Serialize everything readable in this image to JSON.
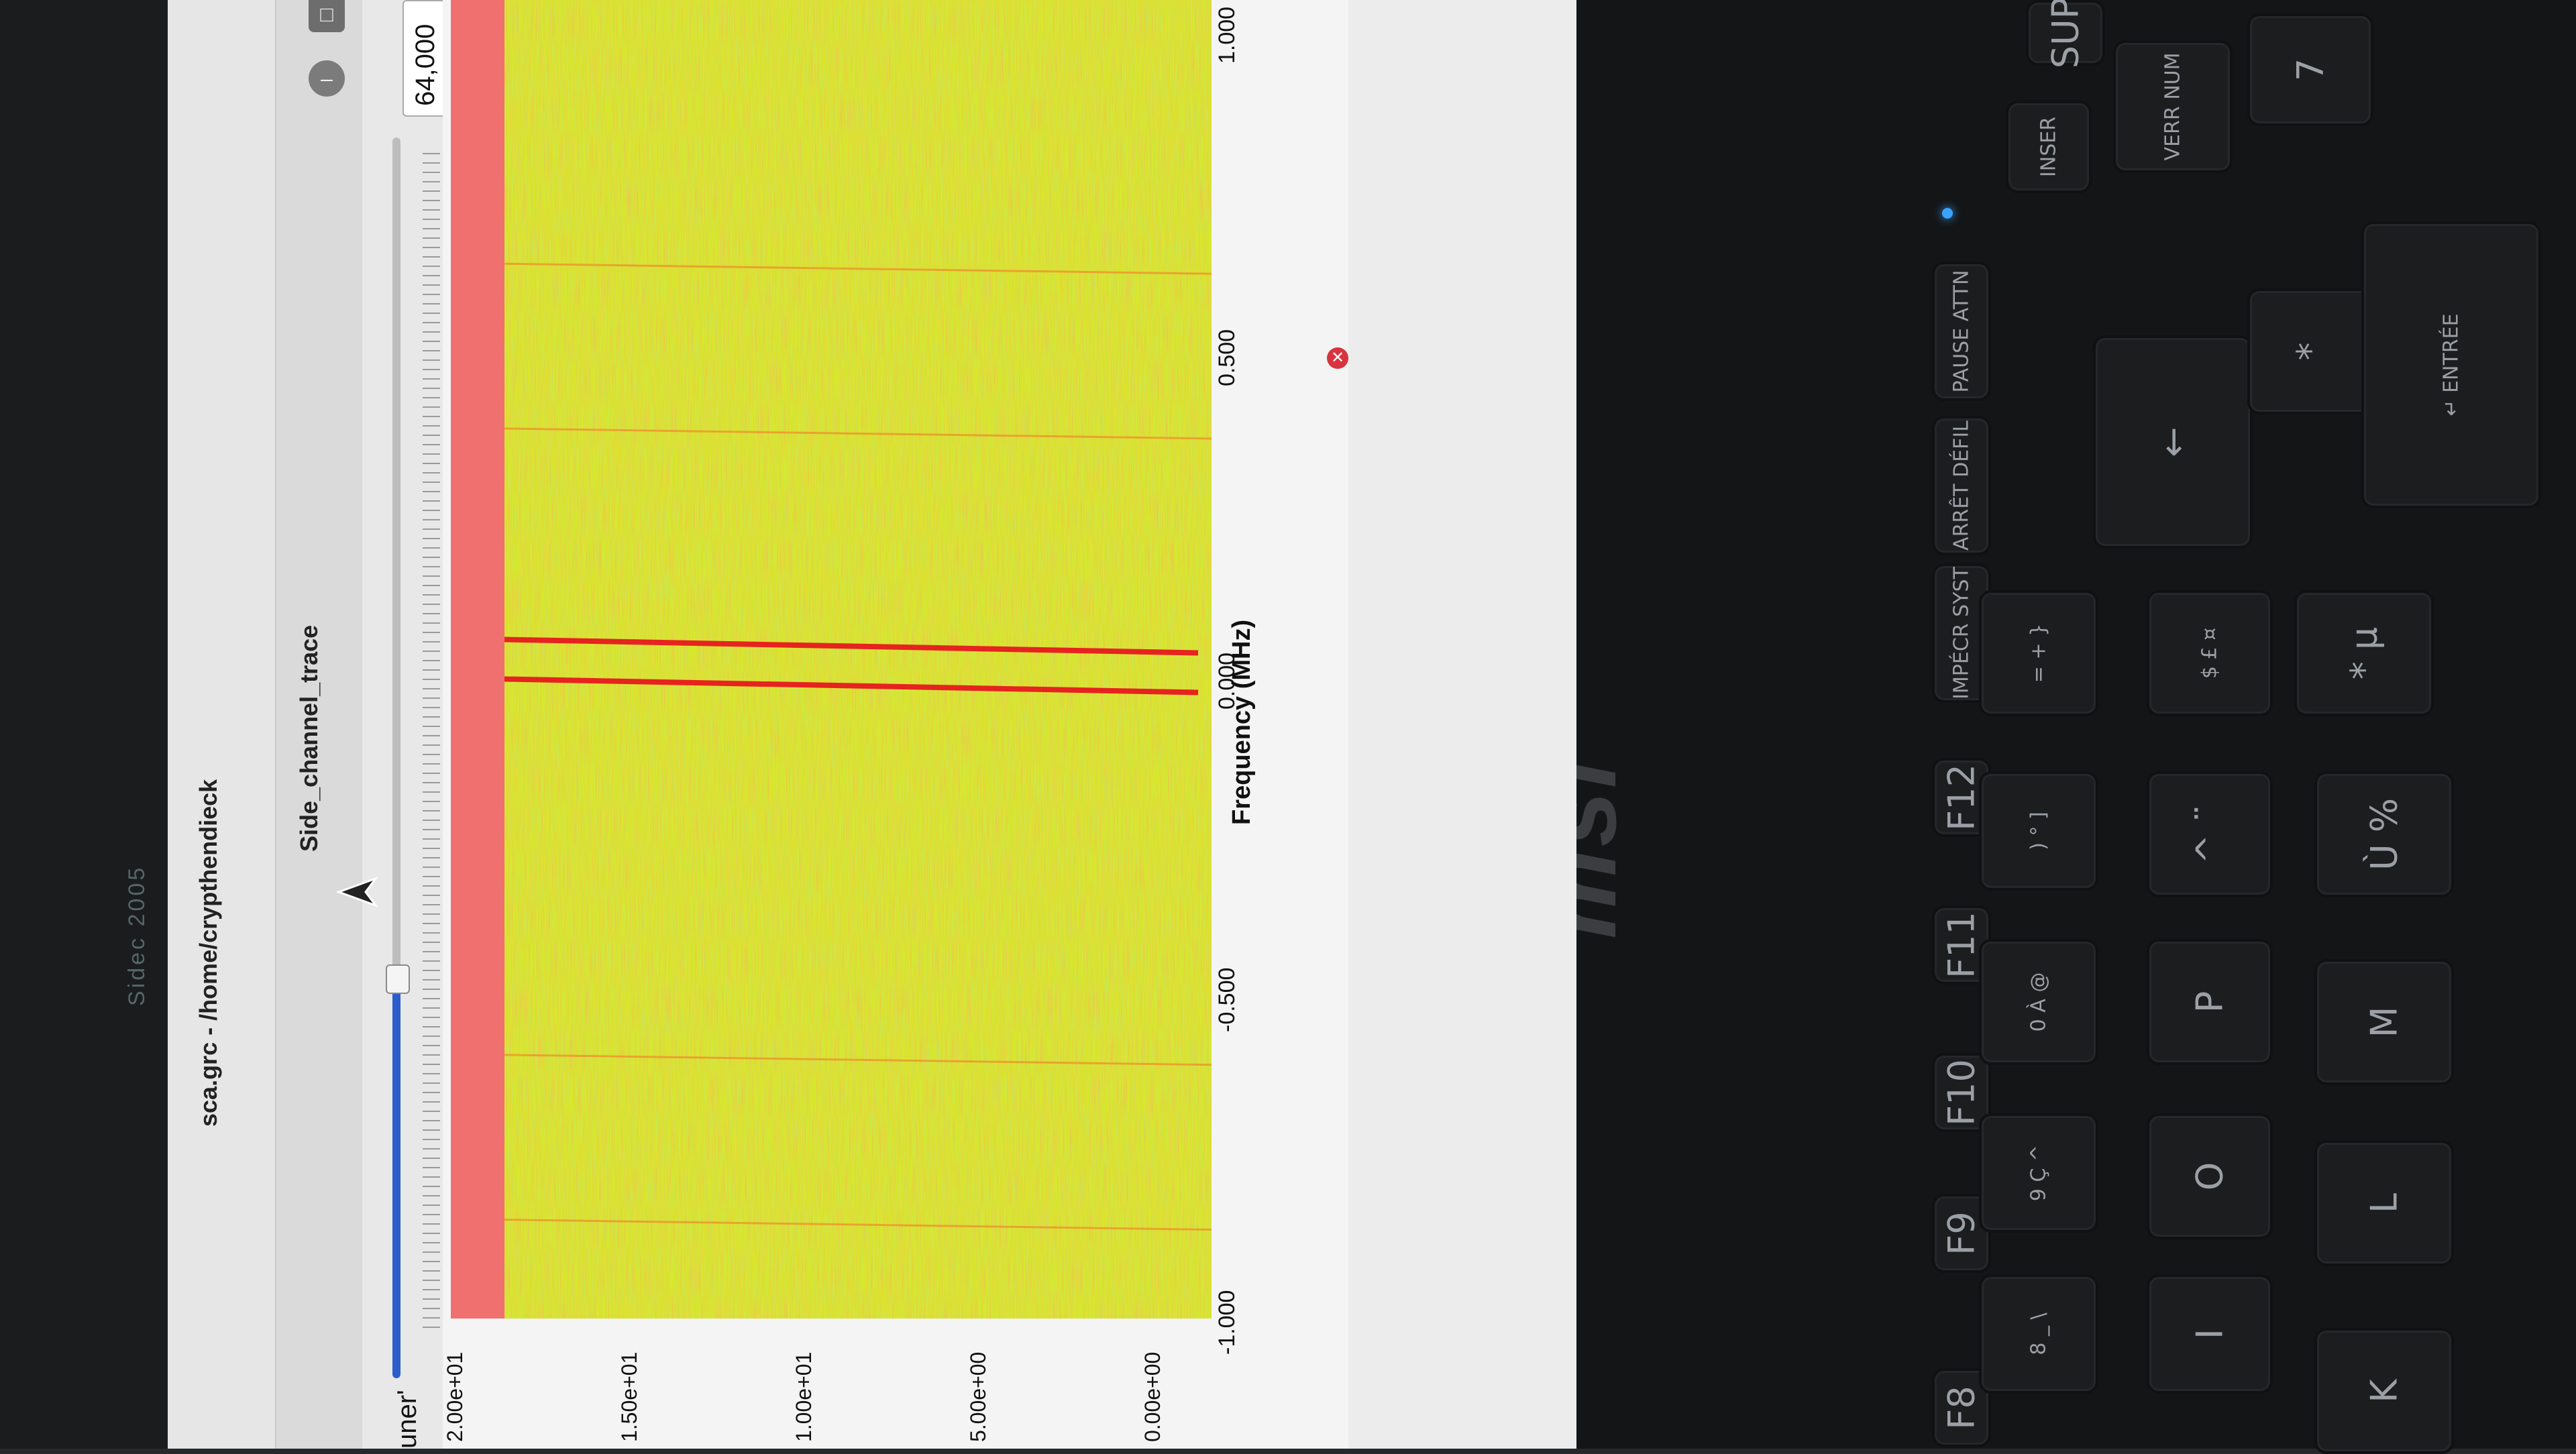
{
  "window": {
    "title": "sca.grc - /home/crypthendieck",
    "minimize_glyph": "–",
    "maximize_glyph": "□"
  },
  "background_label": "Sidec 2005",
  "panel": {
    "title": "Side_channel_trace"
  },
  "slider": {
    "name_fragment": "uner'",
    "value_text": "64,000",
    "level_fraction": 0.3
  },
  "plot": {
    "y_ticks": [
      "2.00e+01",
      "1.50e+01",
      "1.00e+01",
      "5.00e+00",
      "0.00e+00"
    ],
    "x_ticks": [
      "-1.000",
      "-0.500",
      "0.000",
      "0.500",
      "1.000"
    ],
    "x_label": "Frequency (MHz)",
    "close_glyph": "✕"
  },
  "chart_data": {
    "type": "heatmap",
    "xlabel": "Frequency (MHz)",
    "xlim": [
      -1.0,
      1.0
    ],
    "ylim": [
      0,
      20
    ],
    "y_tick_values": [
      0,
      5,
      10,
      15,
      20
    ],
    "peaks_mhz": [
      -0.03,
      0.03
    ],
    "colors": {
      "background": "#d8e82a",
      "noise_hot": "#f08a2a",
      "peak": "#e6231f",
      "top_band": "#f07070"
    }
  },
  "keyboard": {
    "brand": "msi",
    "keys": [
      {
        "label": "F8"
      },
      {
        "label": "F9"
      },
      {
        "label": "F10"
      },
      {
        "label": "F11"
      },
      {
        "label": "F12"
      },
      {
        "label": "IMPÉCR SYST"
      },
      {
        "label": "ARRÊT DÉFIL"
      },
      {
        "label": "PAUSE ATTN"
      },
      {
        "label": "INSER"
      },
      {
        "label": "SUP"
      },
      {
        "label": "8 _ \\"
      },
      {
        "label": "9 Ç ^"
      },
      {
        "label": "0 À @"
      },
      {
        "label": ") ° ]"
      },
      {
        "label": "= + }"
      },
      {
        "label": "←"
      },
      {
        "label": "VERR NUM"
      },
      {
        "label": "7"
      },
      {
        "label": "I"
      },
      {
        "label": "O"
      },
      {
        "label": "P"
      },
      {
        "label": "^ ¨"
      },
      {
        "label": "$ £ ¤"
      },
      {
        "label": "*"
      },
      {
        "label": "K"
      },
      {
        "label": "L"
      },
      {
        "label": "M"
      },
      {
        "label": "Ù %"
      },
      {
        "label": "* µ"
      },
      {
        "label": "↵ ENTRÉE"
      }
    ]
  }
}
